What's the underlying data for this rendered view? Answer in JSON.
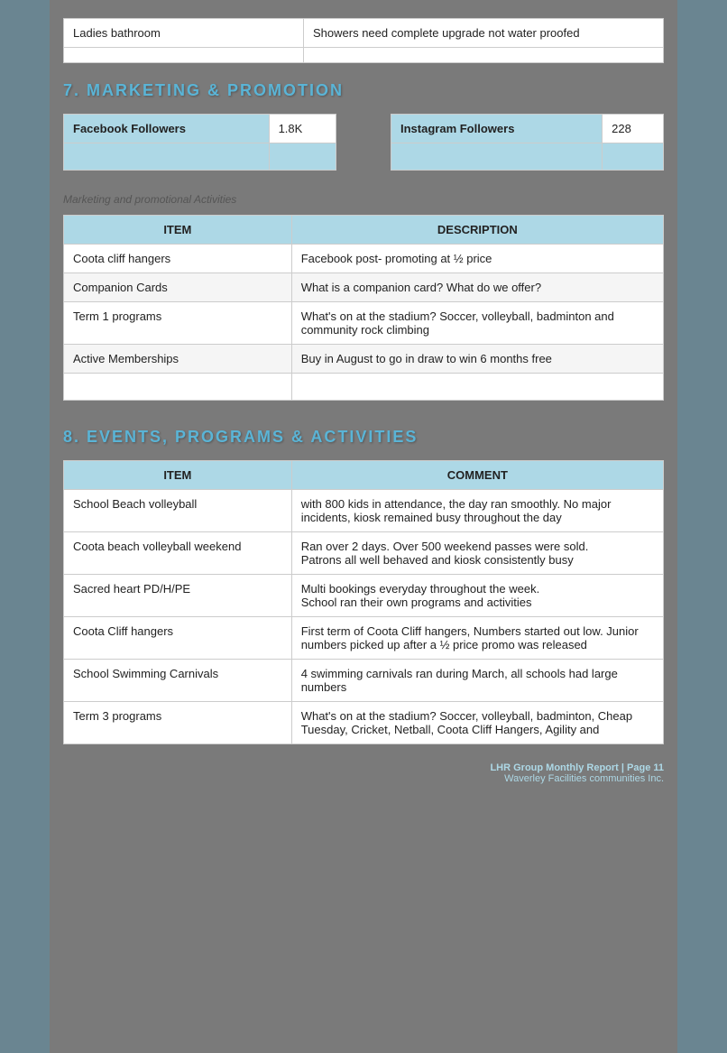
{
  "facilities": {
    "rows": [
      {
        "label": "Ladies bathroom",
        "value": "Showers need complete upgrade not water proofed"
      },
      {
        "label": "",
        "value": ""
      }
    ]
  },
  "marketing": {
    "heading": "7.  MARKETING & PROMOTION",
    "facebook": {
      "label": "Facebook Followers",
      "value": "1.8K"
    },
    "instagram": {
      "label": "Instagram Followers",
      "value": "228"
    },
    "subtitle": "Marketing and promotional Activities",
    "table": {
      "headers": [
        "ITEM",
        "DESCRIPTION"
      ],
      "rows": [
        {
          "item": "Coota cliff hangers",
          "description": "Facebook post- promoting at ½ price"
        },
        {
          "item": "Companion Cards",
          "description": "What is a companion card? What do we offer?"
        },
        {
          "item": "Term 1 programs",
          "description": "What's on at the stadium? Soccer, volleyball, badminton and community rock climbing"
        },
        {
          "item": "Active Memberships",
          "description": "Buy in August to go in draw to win 6 months free"
        },
        {
          "item": "",
          "description": ""
        }
      ]
    }
  },
  "events": {
    "heading": "8.  EVENTS, PROGRAMS & ACTIVITIES",
    "table": {
      "headers": [
        "ITEM",
        "COMMENT"
      ],
      "rows": [
        {
          "item": "School Beach volleyball",
          "description": "with 800 kids in attendance, the day ran smoothly. No major incidents, kiosk remained busy throughout the day"
        },
        {
          "item": "Coota beach volleyball weekend",
          "description": "Ran over 2 days. Over 500 weekend passes were sold.\nPatrons all well behaved and kiosk consistently busy"
        },
        {
          "item": "Sacred heart PD/H/PE",
          "description": "Multi bookings everyday throughout the week.\nSchool ran their own programs and activities"
        },
        {
          "item": "Coota Cliff hangers",
          "description": "First term of Coota Cliff hangers, Numbers started out low. Junior numbers picked up after a ½ price promo was released"
        },
        {
          "item": "School Swimming Carnivals",
          "description": "4 swimming carnivals ran during March, all schools had large numbers"
        },
        {
          "item": "Term 3 programs",
          "description": "What's on at the stadium? Soccer, volleyball, badminton, Cheap Tuesday, Cricket, Netball, Coota Cliff Hangers, Agility and"
        }
      ]
    }
  },
  "footer": {
    "line1": "LHR Group Monthly Report | Page 11",
    "line2": "Waverley Facilities communities Inc."
  }
}
